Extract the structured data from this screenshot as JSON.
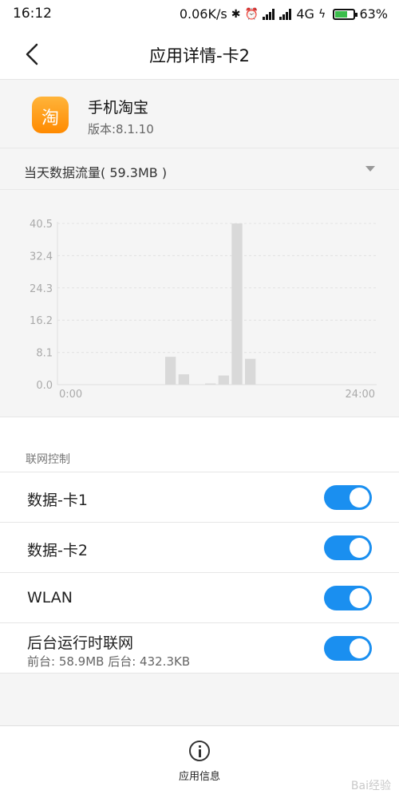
{
  "status_bar": {
    "time": "16:12",
    "network_speed": "0.06K/s",
    "network_type": "4G",
    "battery": "63%",
    "battery_level": 0.63,
    "icons": [
      "bluetooth-icon",
      "alarm-icon",
      "signal-icon",
      "hd-signal-icon",
      "data-saver-icon",
      "battery-icon"
    ]
  },
  "header": {
    "title": "应用详情-卡2",
    "back_icon": "chevron-left-icon"
  },
  "app": {
    "name": "手机淘宝",
    "version": "版本:8.1.10",
    "icon_glyph": "淘",
    "icon_color": "#ff9a1a"
  },
  "traffic": {
    "label": "当天数据流量( 59.3MB )"
  },
  "chart_data": {
    "type": "bar",
    "x_start_label": "0:00",
    "x_end_label": "24:00",
    "ytick_labels": [
      "40.5",
      "32.4",
      "24.3",
      "16.2",
      "8.1",
      "0.0"
    ],
    "ylim": [
      0,
      40.5
    ],
    "x_hours": [
      0,
      24
    ],
    "bar_width_hours": 0.8,
    "hours": [
      8.5,
      9.5,
      11.5,
      12.5,
      13.5,
      14.5
    ],
    "values": [
      7.0,
      2.6,
      0.3,
      2.3,
      40.5,
      6.5
    ],
    "bar_color": "#d9d9d9",
    "grid": true
  },
  "control": {
    "section_title": "联网控制",
    "rows": [
      {
        "label": "数据-卡1",
        "on": true
      },
      {
        "label": "数据-卡2",
        "on": true
      },
      {
        "label": "WLAN",
        "on": true
      },
      {
        "label": "后台运行时联网",
        "sub": "前台: 58.9MB  后台: 432.3KB",
        "on": true
      }
    ],
    "accent": "#1a8ff0"
  },
  "bottom": {
    "info_label": "应用信息",
    "info_icon": "info-icon"
  },
  "watermark": "Bai经验"
}
